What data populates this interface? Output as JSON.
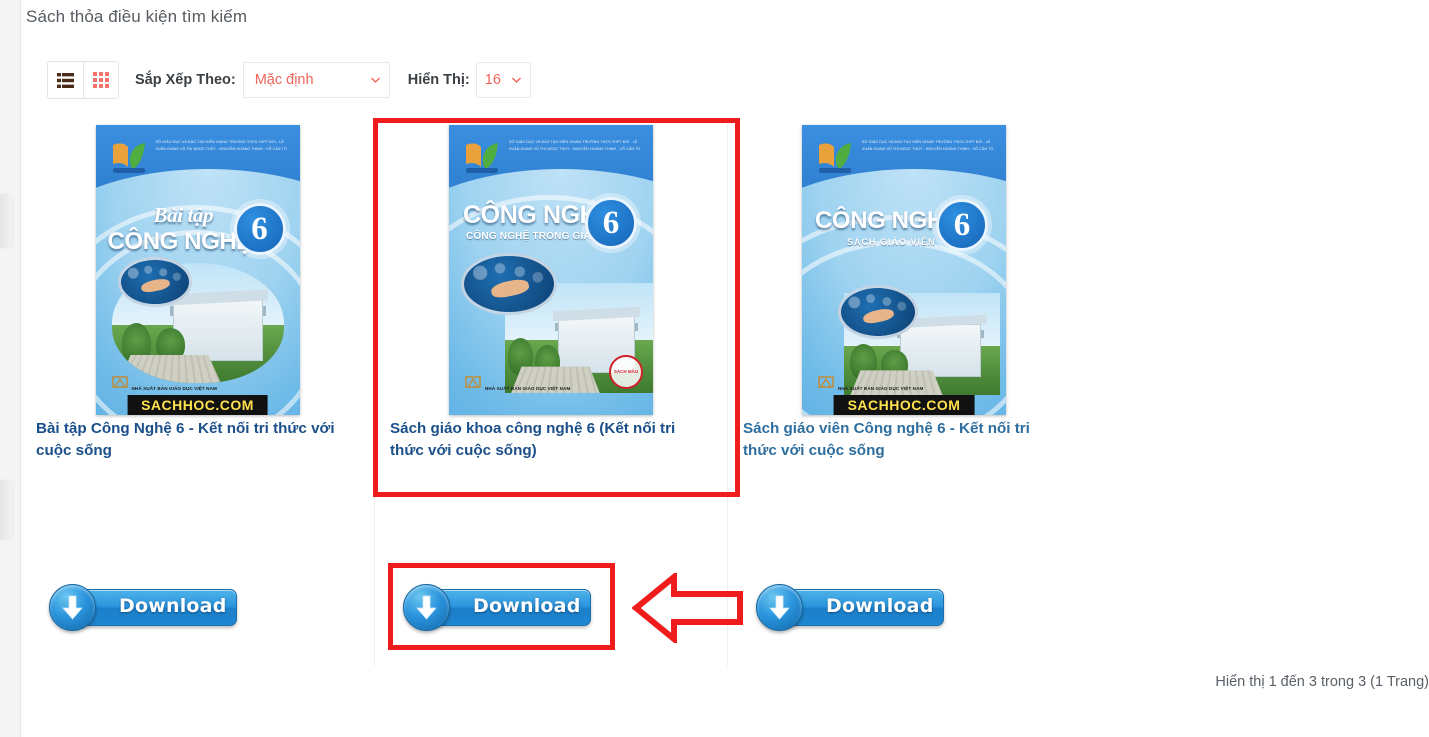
{
  "page": {
    "heading": "Sách thỏa điều kiện tìm kiếm",
    "result_count": "Hiển thị 1 đến 3 trong 3 (1 Trang)"
  },
  "toolbar": {
    "list_view_icon": "list-view-icon",
    "grid_view_icon": "grid-view-icon",
    "sort_label": "Sắp Xếp Theo:",
    "sort_value": "Mặc định",
    "show_label": "Hiển Thị:",
    "show_value": "16",
    "caret_icon": "chevron-down-icon",
    "accent_color": "#f1655a",
    "label_color": "#3b4045"
  },
  "products": [
    {
      "title": "Bài tập Công Nghệ 6 - Kết nối tri thức với cuộc sống",
      "download_label": "Download",
      "cover": {
        "credits": "SỞ GIÁO DỤC VÀ ĐÀO TẠO KIÊN GIANG\nTRƯỜNG THCS-THPT ĐỐI - LÊ XUÂN GIANG\nVŨ THỊ NGỌC THÚY - NGUYỄN HOÀNG THỊNH - VÕ CẦN TỚ",
        "line1": "Bài tập",
        "line2": "CÔNG NGHỆ",
        "grade": "6",
        "publisher": "NHÀ XUẤT BẢN GIÁO DỤC VIỆT NAM",
        "watermark": "SACHHOC.COM",
        "seal": ""
      }
    },
    {
      "title": "Sách giáo khoa công nghệ 6 (Kết nối tri thức với cuộc sống)",
      "download_label": "Download",
      "cover": {
        "credits": "SỞ GIÁO DỤC VÀ ĐÀO TẠO KIÊN GIANG\nTRƯỜNG THCS-THPT ĐỐI - LÊ XUÂN GIANG\nVŨ THỊ NGỌC THÚY - NGUYỄN HOÀNG THỊNH - VÕ CẦN TỚ",
        "line1": "CÔNG NGHỆ",
        "line2": "CÔNG NGHỆ TRONG GIA ĐÌNH",
        "grade": "6",
        "publisher": "NHÀ XUẤT BẢN GIÁO DỤC VIỆT NAM",
        "watermark": "",
        "seal": "SÁCH MẪU"
      }
    },
    {
      "title": "Sách giáo viên Công nghệ 6 - Kết nối tri thức với cuộc sống",
      "download_label": "Download",
      "cover": {
        "credits": "SỞ GIÁO DỤC VÀ ĐÀO TẠO KIÊN GIANG\nTRƯỜNG THCS-THPT ĐỐI - LÊ XUÂN GIANG\nVŨ THỊ NGỌC THÚY - NGUYỄN HOÀNG THỊNH - VÕ CẦN TỚ",
        "line1": "CÔNG NGHỆ",
        "line2": "SÁCH GIÁO VIÊN",
        "grade": "6",
        "publisher": "NHÀ XUẤT BẢN GIÁO DỤC VIỆT NAM",
        "watermark": "SACHHOC.COM",
        "seal": ""
      }
    }
  ],
  "annotations": {
    "color": "#ee1c1c",
    "highlight_product_box": "highlight-box-product-2",
    "highlight_download_box": "highlight-box-download-2",
    "pointer_icon": "left-arrow-annotation"
  }
}
